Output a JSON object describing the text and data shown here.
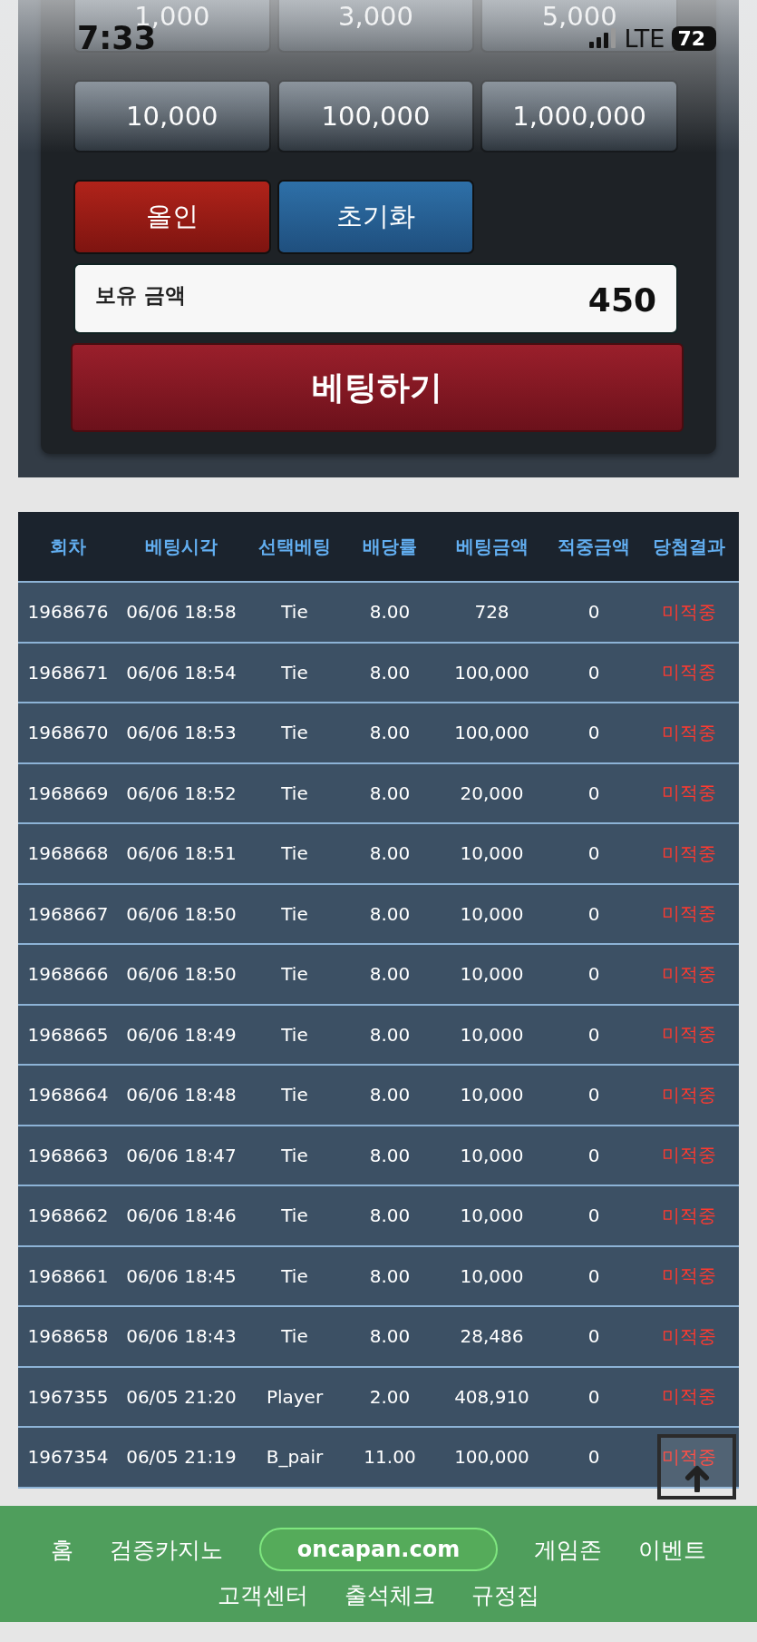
{
  "status_bar": {
    "time": "7:33",
    "network": "LTE",
    "battery": "72"
  },
  "chips": [
    "1,000",
    "3,000",
    "5,000",
    "10,000",
    "100,000",
    "1,000,000"
  ],
  "actions": [
    {
      "label": "올인",
      "kind": "allin"
    },
    {
      "label": "초기화",
      "kind": "reset"
    }
  ],
  "balance": {
    "label": "보유 금액",
    "value": "450"
  },
  "submit": "베팅하기",
  "table": {
    "columns": [
      "회차",
      "베팅시각",
      "선택베팅",
      "배당률",
      "베팅금액",
      "적중금액",
      "당첨결과"
    ],
    "rows": [
      [
        "1968676",
        "06/06 18:58",
        "Tie",
        "8.00",
        "728",
        "0",
        "미적중"
      ],
      [
        "1968671",
        "06/06 18:54",
        "Tie",
        "8.00",
        "100,000",
        "0",
        "미적중"
      ],
      [
        "1968670",
        "06/06 18:53",
        "Tie",
        "8.00",
        "100,000",
        "0",
        "미적중"
      ],
      [
        "1968669",
        "06/06 18:52",
        "Tie",
        "8.00",
        "20,000",
        "0",
        "미적중"
      ],
      [
        "1968668",
        "06/06 18:51",
        "Tie",
        "8.00",
        "10,000",
        "0",
        "미적중"
      ],
      [
        "1968667",
        "06/06 18:50",
        "Tie",
        "8.00",
        "10,000",
        "0",
        "미적중"
      ],
      [
        "1968666",
        "06/06 18:50",
        "Tie",
        "8.00",
        "10,000",
        "0",
        "미적중"
      ],
      [
        "1968665",
        "06/06 18:49",
        "Tie",
        "8.00",
        "10,000",
        "0",
        "미적중"
      ],
      [
        "1968664",
        "06/06 18:48",
        "Tie",
        "8.00",
        "10,000",
        "0",
        "미적중"
      ],
      [
        "1968663",
        "06/06 18:47",
        "Tie",
        "8.00",
        "10,000",
        "0",
        "미적중"
      ],
      [
        "1968662",
        "06/06 18:46",
        "Tie",
        "8.00",
        "10,000",
        "0",
        "미적중"
      ],
      [
        "1968661",
        "06/06 18:45",
        "Tie",
        "8.00",
        "10,000",
        "0",
        "미적중"
      ],
      [
        "1968658",
        "06/06 18:43",
        "Tie",
        "8.00",
        "28,486",
        "0",
        "미적중"
      ],
      [
        "1967355",
        "06/05 21:20",
        "Player",
        "2.00",
        "408,910",
        "0",
        "미적중"
      ],
      [
        "1967354",
        "06/05 21:19",
        "B_pair",
        "11.00",
        "100,000",
        "0",
        "미적중"
      ]
    ]
  },
  "footer": {
    "nav_rows": [
      [
        "홈",
        "검증카지노",
        "게임존",
        "이벤트"
      ],
      [
        "고객센터",
        "출석체크",
        "규정집"
      ]
    ],
    "url": "oncapan.com"
  }
}
